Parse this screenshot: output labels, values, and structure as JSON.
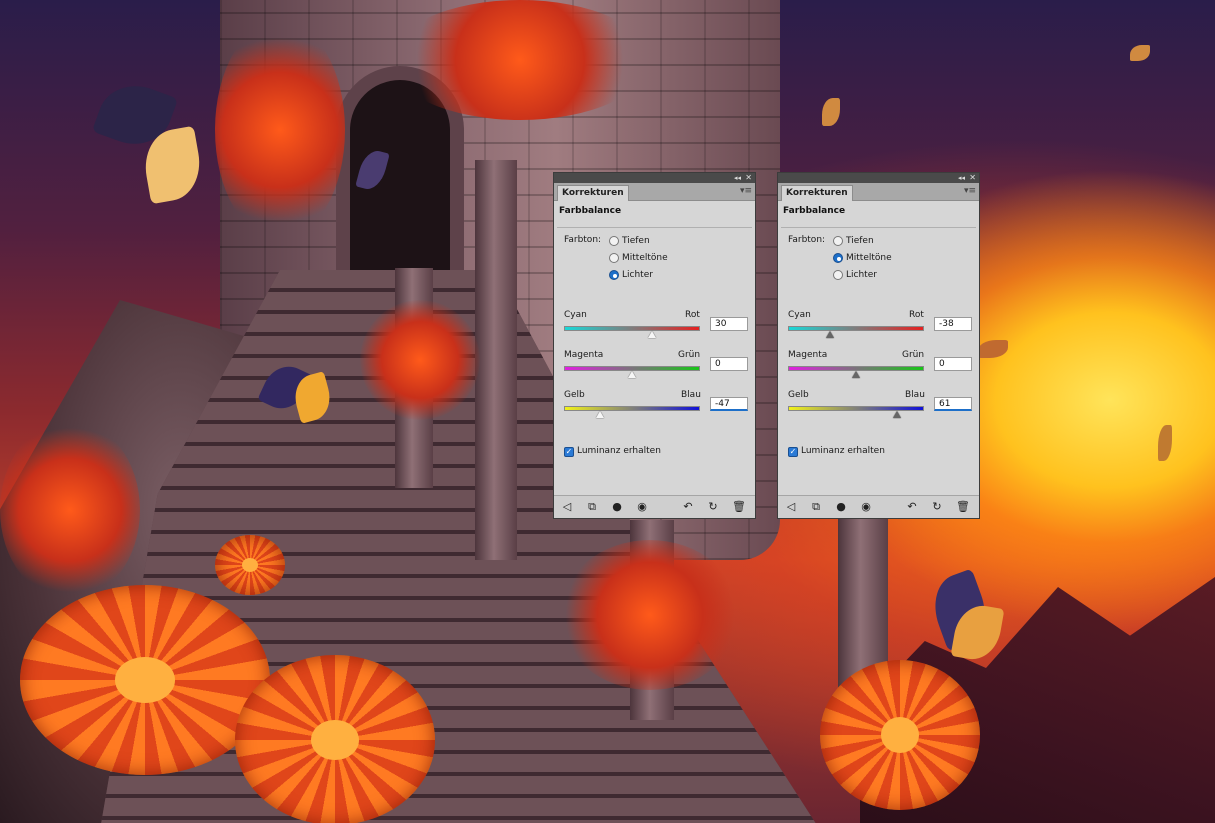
{
  "panels": [
    {
      "tab_title": "Korrekturen",
      "heading": "Farbbalance",
      "tone_label": "Farbton:",
      "tone_options": [
        "Tiefen",
        "Mitteltöne",
        "Lichter"
      ],
      "selected_tone": "Lichter",
      "sliders": [
        {
          "left_label": "Cyan",
          "right_label": "Rot",
          "value": "30"
        },
        {
          "left_label": "Magenta",
          "right_label": "Grün",
          "value": "0"
        },
        {
          "left_label": "Gelb",
          "right_label": "Blau",
          "value": "-47"
        }
      ],
      "preserve_luminosity_label": "Luminanz erhalten",
      "preserve_luminosity_checked": true
    },
    {
      "tab_title": "Korrekturen",
      "heading": "Farbbalance",
      "tone_label": "Farbton:",
      "tone_options": [
        "Tiefen",
        "Mitteltöne",
        "Lichter"
      ],
      "selected_tone": "Mitteltöne",
      "sliders": [
        {
          "left_label": "Cyan",
          "right_label": "Rot",
          "value": "-38"
        },
        {
          "left_label": "Magenta",
          "right_label": "Grün",
          "value": "0"
        },
        {
          "left_label": "Gelb",
          "right_label": "Blau",
          "value": "61"
        }
      ],
      "preserve_luminosity_label": "Luminanz erhalten",
      "preserve_luminosity_checked": true
    }
  ],
  "footer_icons": [
    "clip-to-layer-icon",
    "layer-visibility-icon",
    "eye-icon",
    "view-previous-icon",
    "reset-icon",
    "delete-icon"
  ],
  "colors": {
    "accent": "#1d6fc9",
    "panel_bg": "#d6d6d6",
    "titlebar": "#4a4a4a"
  }
}
